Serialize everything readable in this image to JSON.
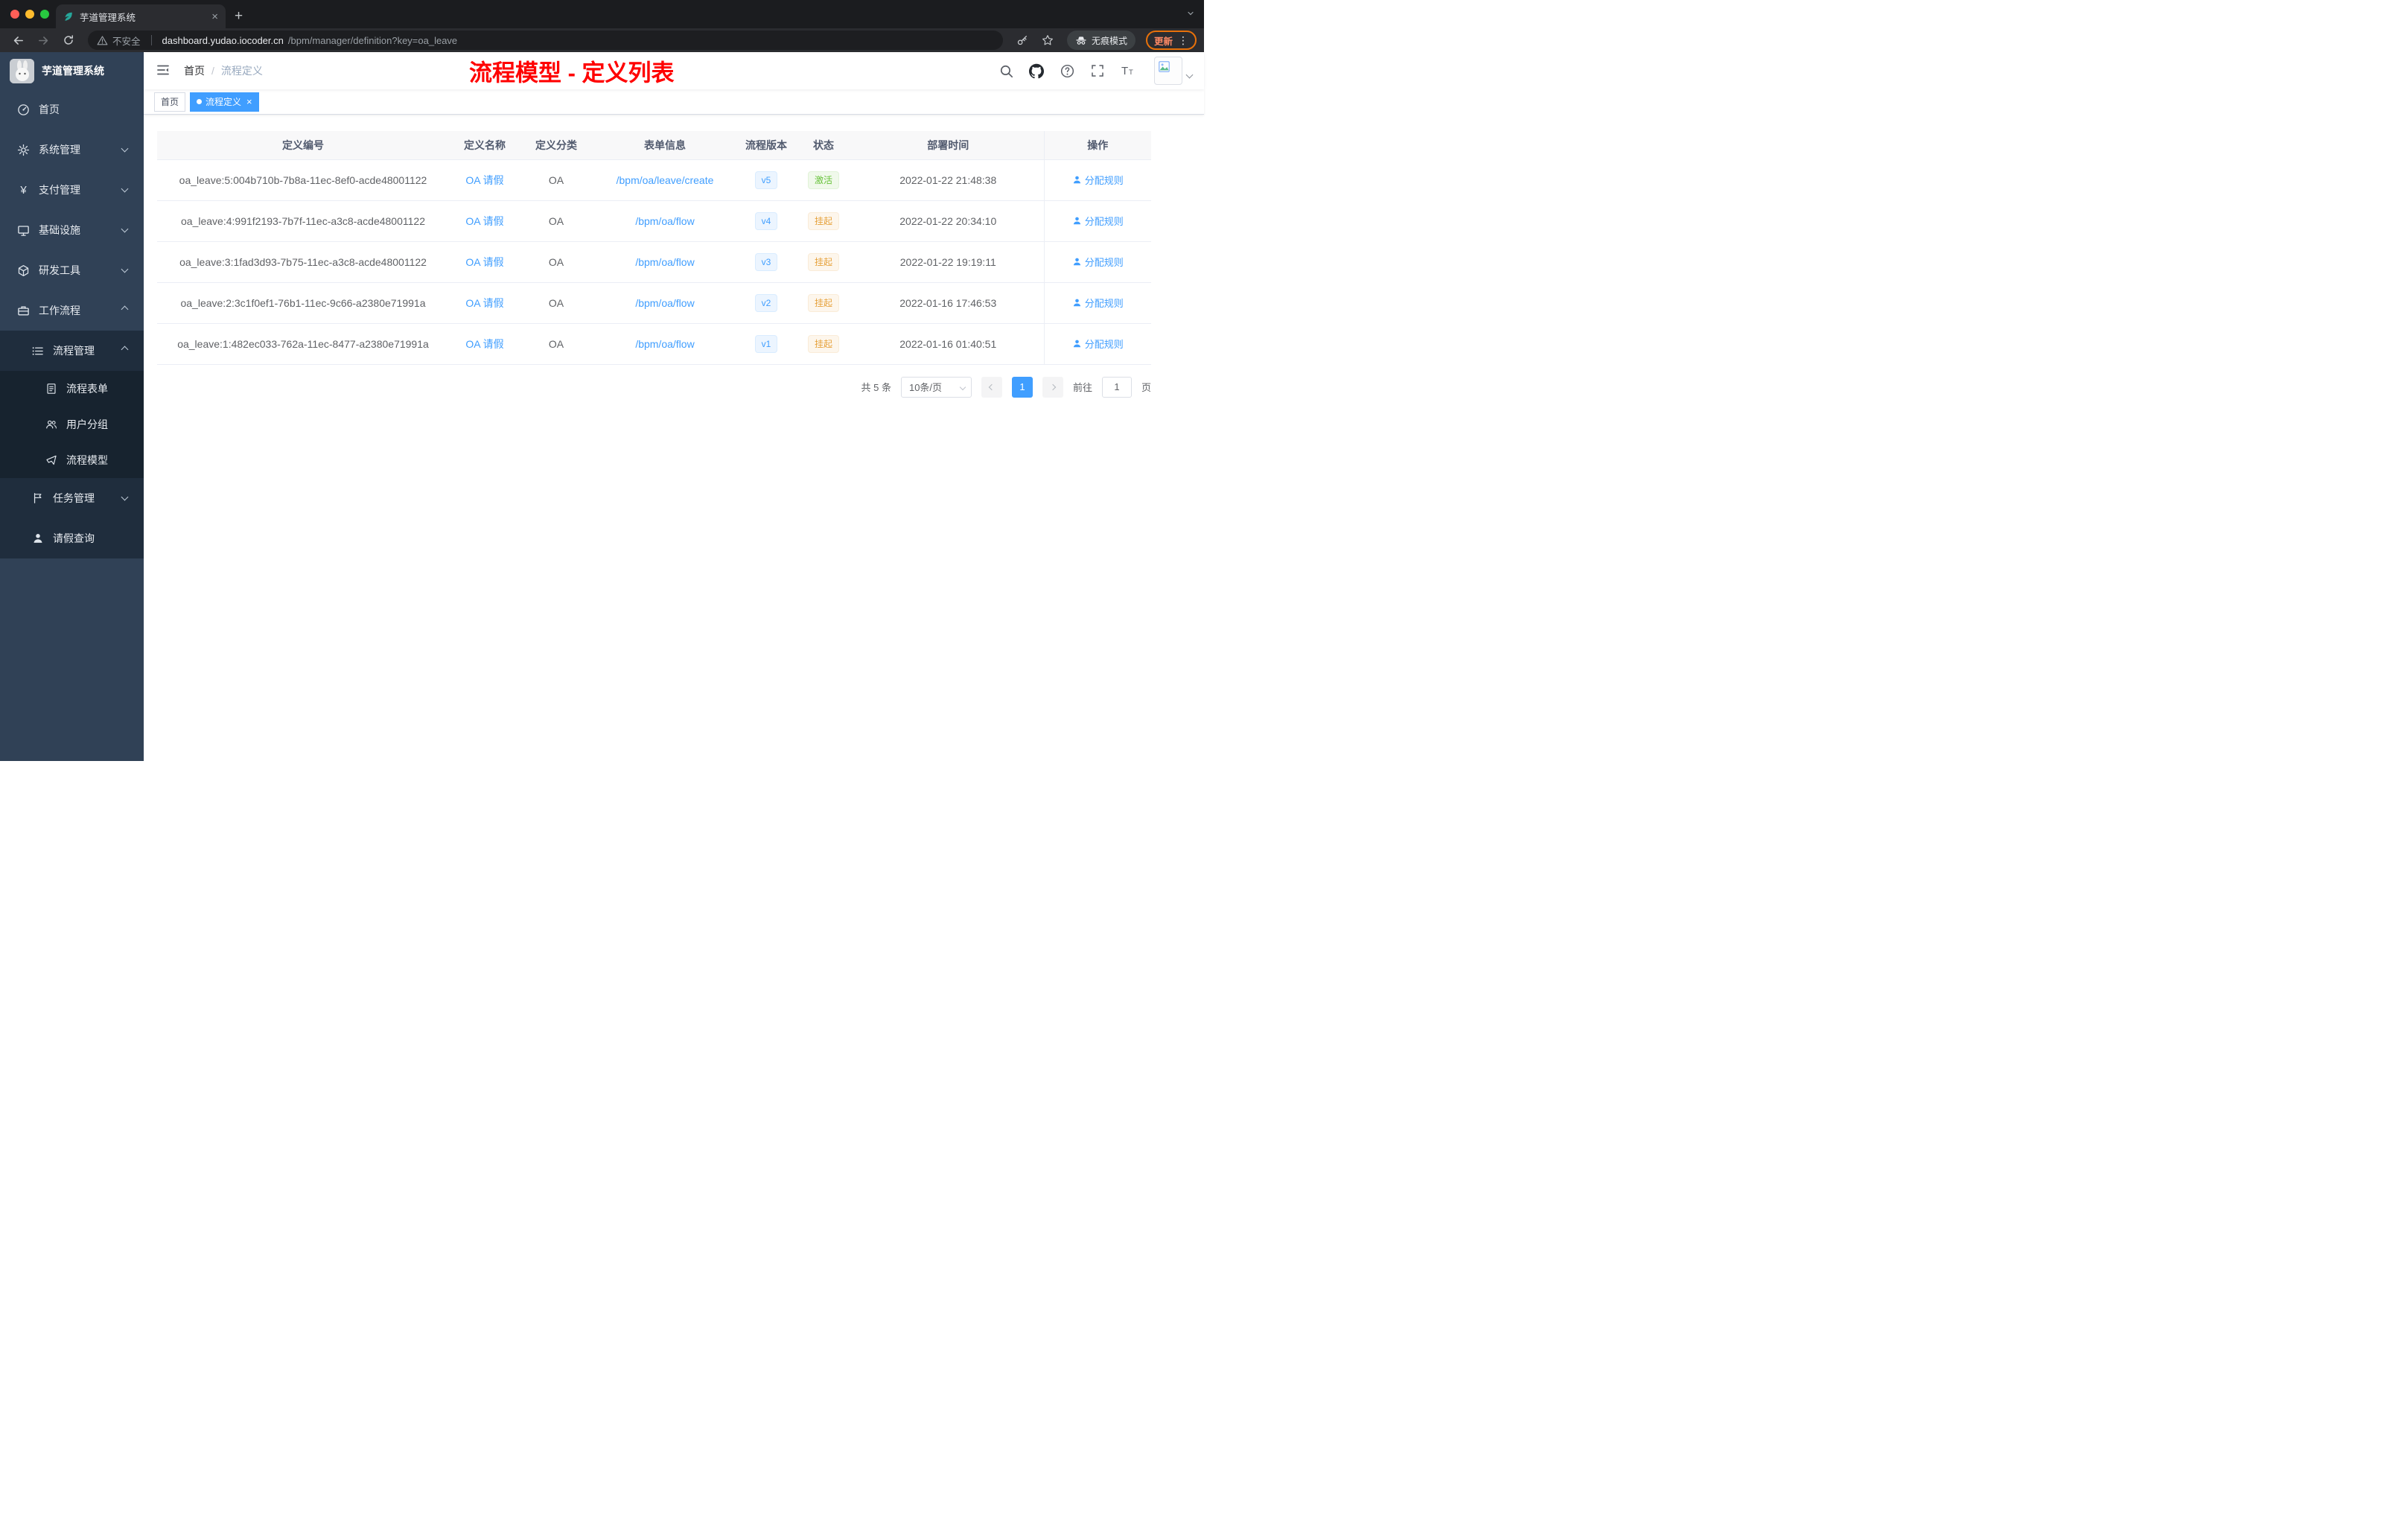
{
  "browser": {
    "tab_title": "芋道管理系统",
    "security_label": "不安全",
    "url_host": "dashboard.yudao.iocoder.cn",
    "url_path": "/bpm/manager/definition?key=oa_leave",
    "incognito_label": "无痕模式",
    "update_label": "更新"
  },
  "sidebar": {
    "logo_title": "芋道管理系统",
    "items": [
      {
        "label": "首页"
      },
      {
        "label": "系统管理"
      },
      {
        "label": "支付管理"
      },
      {
        "label": "基础设施"
      },
      {
        "label": "研发工具"
      },
      {
        "label": "工作流程"
      },
      {
        "label": "流程管理"
      },
      {
        "label": "流程表单"
      },
      {
        "label": "用户分组"
      },
      {
        "label": "流程模型"
      },
      {
        "label": "任务管理"
      },
      {
        "label": "请假查询"
      }
    ]
  },
  "header": {
    "breadcrumb": {
      "home": "首页",
      "separator": "/",
      "current": "流程定义"
    },
    "annotation": "流程模型 - 定义列表"
  },
  "tags": {
    "home": "首页",
    "active": "流程定义"
  },
  "table": {
    "columns": {
      "id": "定义编号",
      "name": "定义名称",
      "category": "定义分类",
      "form": "表单信息",
      "version": "流程版本",
      "status": "状态",
      "deploy": "部署时间",
      "ops": "操作"
    },
    "rows": [
      {
        "id": "oa_leave:5:004b710b-7b8a-11ec-8ef0-acde48001122",
        "name": "OA 请假",
        "category": "OA",
        "form": "/bpm/oa/leave/create",
        "version": "v5",
        "status": "激活",
        "deploy": "2022-01-22 21:48:38",
        "action": "分配规则"
      },
      {
        "id": "oa_leave:4:991f2193-7b7f-11ec-a3c8-acde48001122",
        "name": "OA 请假",
        "category": "OA",
        "form": "/bpm/oa/flow",
        "version": "v4",
        "status": "挂起",
        "deploy": "2022-01-22 20:34:10",
        "action": "分配规则"
      },
      {
        "id": "oa_leave:3:1fad3d93-7b75-11ec-a3c8-acde48001122",
        "name": "OA 请假",
        "category": "OA",
        "form": "/bpm/oa/flow",
        "version": "v3",
        "status": "挂起",
        "deploy": "2022-01-22 19:19:11",
        "action": "分配规则"
      },
      {
        "id": "oa_leave:2:3c1f0ef1-76b1-11ec-9c66-a2380e71991a",
        "name": "OA 请假",
        "category": "OA",
        "form": "/bpm/oa/flow",
        "version": "v2",
        "status": "挂起",
        "deploy": "2022-01-16 17:46:53",
        "action": "分配规则"
      },
      {
        "id": "oa_leave:1:482ec033-762a-11ec-8477-a2380e71991a",
        "name": "OA 请假",
        "category": "OA",
        "form": "/bpm/oa/flow",
        "version": "v1",
        "status": "挂起",
        "deploy": "2022-01-16 01:40:51",
        "action": "分配规则"
      }
    ]
  },
  "pagination": {
    "total": "共 5 条",
    "page_size": "10条/页",
    "page": "1",
    "goto": "前往",
    "goto_value": "1",
    "unit": "页"
  },
  "colors": {
    "accent": "#409eff",
    "success": "#67c23a",
    "warning": "#e6a23c",
    "annotation_red": "#ff0000"
  }
}
